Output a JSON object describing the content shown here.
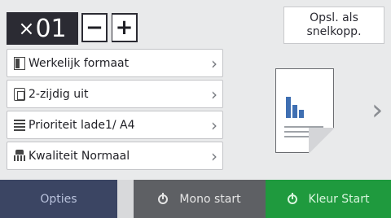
{
  "copy_counter": {
    "prefix": "×",
    "value": "01"
  },
  "steppers": {
    "minus": "−",
    "plus": "+"
  },
  "shortcut": {
    "line1": "Opsl. als",
    "line2": "snelkopp."
  },
  "settings": [
    {
      "label": "Werkelijk formaat",
      "icon": "page-size-icon"
    },
    {
      "label": "2-zijdig uit",
      "icon": "duplex-icon"
    },
    {
      "label": "Prioriteit lade1/ A4",
      "icon": "tray-icon"
    },
    {
      "label": "Kwaliteit Normaal",
      "icon": "quality-icon"
    }
  ],
  "chevron": "›",
  "next_arrow": "›",
  "bottom_bar": {
    "options": "Opties",
    "mono_start": "Mono start",
    "color_start": "Kleur Start"
  },
  "colors": {
    "counter_bg": "#2b2b33",
    "options_bg": "#3b4563",
    "mono_bg": "#5e6064",
    "color_bg": "#1f9a3e"
  }
}
